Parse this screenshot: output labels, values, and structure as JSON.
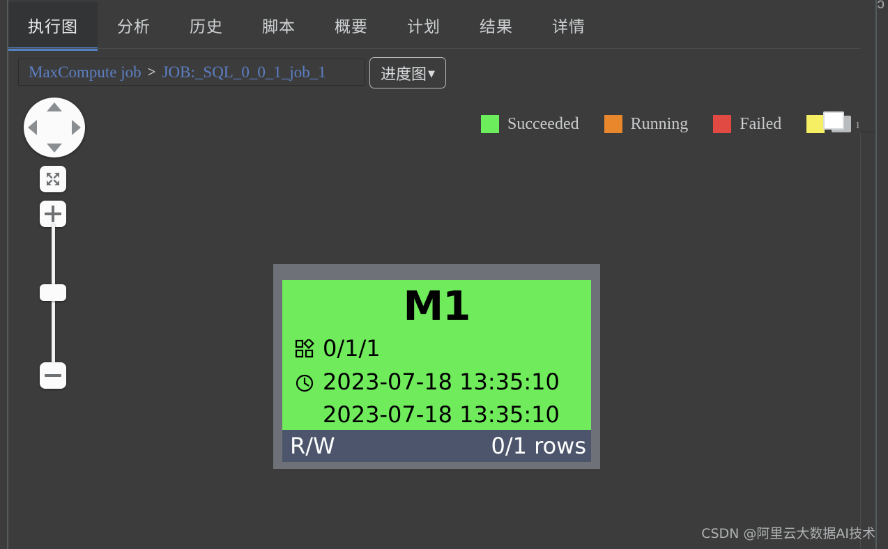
{
  "tabs": [
    {
      "label": "执行图",
      "active": true
    },
    {
      "label": "分析",
      "active": false
    },
    {
      "label": "历史",
      "active": false
    },
    {
      "label": "脚本",
      "active": false
    },
    {
      "label": "概要",
      "active": false
    },
    {
      "label": "计划",
      "active": false
    },
    {
      "label": "结果",
      "active": false
    },
    {
      "label": "详情",
      "active": false
    }
  ],
  "toolbar": {
    "breadcrumb": {
      "root": "MaxCompute job",
      "separator": ">",
      "current": "JOB:_SQL_0_0_1_job_1"
    },
    "view_dropdown": {
      "label": "进度图",
      "caret": "▼"
    }
  },
  "legend": {
    "items": [
      {
        "label": "Succeeded",
        "color": "#6ced5c"
      },
      {
        "label": "Running",
        "color": "#e8872c"
      },
      {
        "label": "Failed",
        "color": "#e04a42"
      },
      {
        "label": "I",
        "color": "#f6ef63",
        "clipped": true
      }
    ],
    "tail_text": "ı"
  },
  "map_controls": {
    "pan": {
      "up": "pan-up",
      "down": "pan-down",
      "left": "pan-left",
      "right": "pan-right"
    },
    "fit_label": "fit-to-screen",
    "zoom_in_label": "+",
    "zoom_out_label": "−"
  },
  "node": {
    "title": "M1",
    "status_color": "#6feb5c",
    "instances": "0/1/1",
    "start_time": "2023-07-18 13:35:10",
    "end_time": "2023-07-18 13:35:10",
    "footer_left": "R/W",
    "footer_right": "0/1 rows",
    "footer_color": "#4c556b"
  },
  "watermark": "CSDN @阿里云大数据AI技术",
  "stray_glyph": "ɔ",
  "theme": {
    "canvas_bg": "#3c3c3c",
    "accent_blue": "#5183c4",
    "link_blue": "#5d7fc4",
    "card_frame": "#6e7278"
  }
}
